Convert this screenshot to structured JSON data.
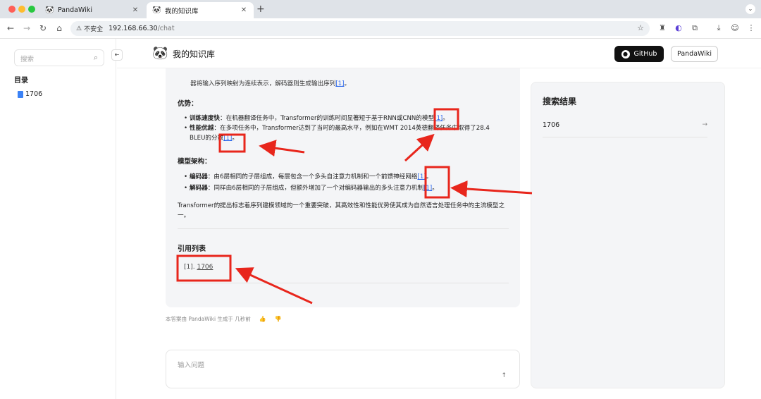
{
  "browser": {
    "tabs": [
      {
        "title": "PandaWiki",
        "active": false
      },
      {
        "title": "我的知识库",
        "active": true
      }
    ],
    "security_label": "不安全",
    "url_host": "192.168.66.30",
    "url_path": "/chat"
  },
  "sidebar": {
    "search_placeholder": "搜索",
    "toc_title": "目录",
    "items": [
      {
        "label": "1706"
      }
    ]
  },
  "header": {
    "site_title": "我的知识库",
    "github_label": "GitHub",
    "pandawiki_label": "PandaWiki"
  },
  "answer": {
    "clipped_line": "器将输入序列映射为连续表示，解码器则生成输出序列",
    "clipped_ref": "[1]",
    "advantages_heading": "优势：",
    "advantages": [
      {
        "term": "训练速度快",
        "text": "：在机器翻译任务中，Transformer的训练时间显著短于基于RNN或CNN的模型",
        "ref": "[1]",
        "tail": "。"
      },
      {
        "term": "性能优越",
        "text": "：在多项任务中，Transformer达到了当时的最高水平，例如在WMT 2014英德翻译任务中取得了28.4 BLEU的分数",
        "ref": "[1]",
        "tail": "。"
      }
    ],
    "architecture_heading": "模型架构：",
    "architecture": [
      {
        "term": "编码器",
        "text": "：由6层相同的子层组成，每层包含一个多头自注意力机制和一个前馈神经网络",
        "ref": "[1]",
        "tail": "。"
      },
      {
        "term": "解码器",
        "text": "：同样由6层相同的子层组成，但额外增加了一个对编码器输出的多头注意力机制",
        "ref": "[1]",
        "tail": "。"
      }
    ],
    "summary": "Transformer的提出标志着序列建模领域的一个重要突破，其高效性和性能优势使其成为自然语言处理任务中的主流模型之一。",
    "citations_heading": "引用列表",
    "citations": [
      {
        "index": "[1].",
        "title": "1706"
      }
    ]
  },
  "meta": {
    "generated_text": "本答案由 PandaWiki 生成于 几秒前"
  },
  "input": {
    "placeholder": "输入问题"
  },
  "search_results": {
    "title": "搜索结果",
    "items": [
      {
        "label": "1706"
      }
    ]
  },
  "colors": {
    "accent_link": "#2563eb",
    "annotation_red": "#e8261c",
    "github_button_bg": "#111111"
  }
}
